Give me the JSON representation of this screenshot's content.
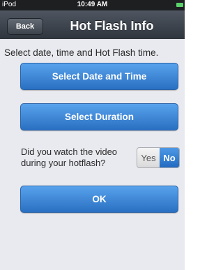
{
  "status_bar": {
    "device": "iPod",
    "time": "10:49 AM"
  },
  "nav": {
    "back_label": "Back",
    "title": "Hot Flash Info"
  },
  "main": {
    "instruction": "Select date, time and Hot Flash time.",
    "select_date_label": "Select Date and Time",
    "select_duration_label": "Select Duration",
    "video_question": "Did you watch the video during your hotflash?",
    "toggle": {
      "yes_label": "Yes",
      "no_label": "No",
      "selected": "No"
    },
    "ok_label": "OK"
  },
  "colors": {
    "accent": "#2f78cf",
    "nav_bar": "#3a4048",
    "background": "#e9eaef"
  },
  "icons": {
    "battery": "battery-icon"
  }
}
